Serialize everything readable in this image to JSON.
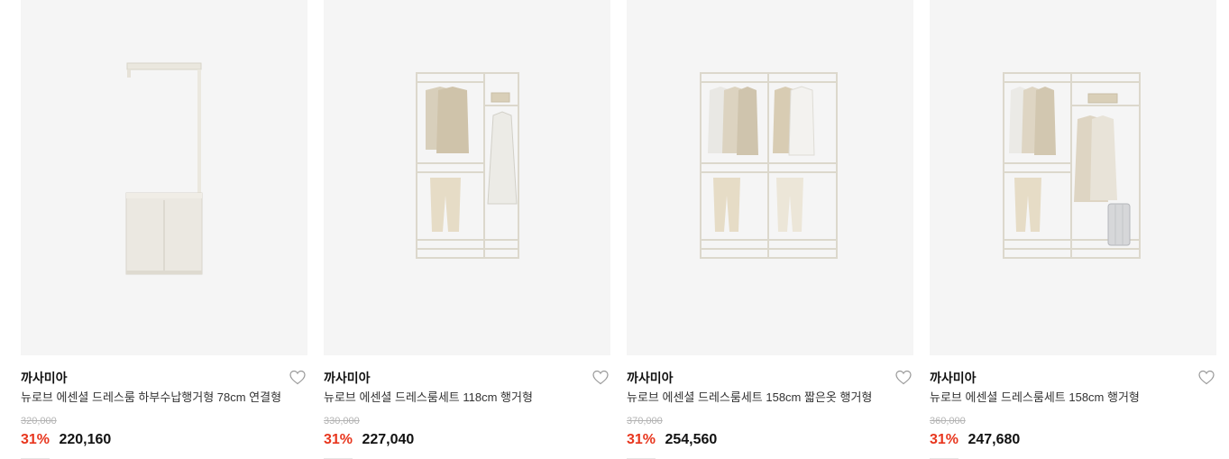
{
  "products": [
    {
      "brand": "까사미아",
      "title": "뉴로브 에센셜 드레스룸 하부수납행거형 78cm 연결형",
      "original_price": "320,000",
      "discount": "31%",
      "price": "220,160",
      "wish_icon": "heart-outline-icon"
    },
    {
      "brand": "까사미아",
      "title": "뉴로브 에센셜 드레스룸세트 118cm 행거형",
      "original_price": "330,000",
      "discount": "31%",
      "price": "227,040",
      "wish_icon": "heart-outline-icon"
    },
    {
      "brand": "까사미아",
      "title": "뉴로브 에센셜 드레스룸세트 158cm 짧은옷 행거형",
      "original_price": "370,000",
      "discount": "31%",
      "price": "254,560",
      "wish_icon": "heart-outline-icon"
    },
    {
      "brand": "까사미아",
      "title": "뉴로브 에센셜 드레스룸세트 158cm 행거형",
      "original_price": "360,000",
      "discount": "31%",
      "price": "247,680",
      "wish_icon": "heart-outline-icon"
    }
  ],
  "colors": {
    "discount": "#e8361e",
    "thumb_bg": "#f5f5f5",
    "frame": "#e9e6dd"
  }
}
